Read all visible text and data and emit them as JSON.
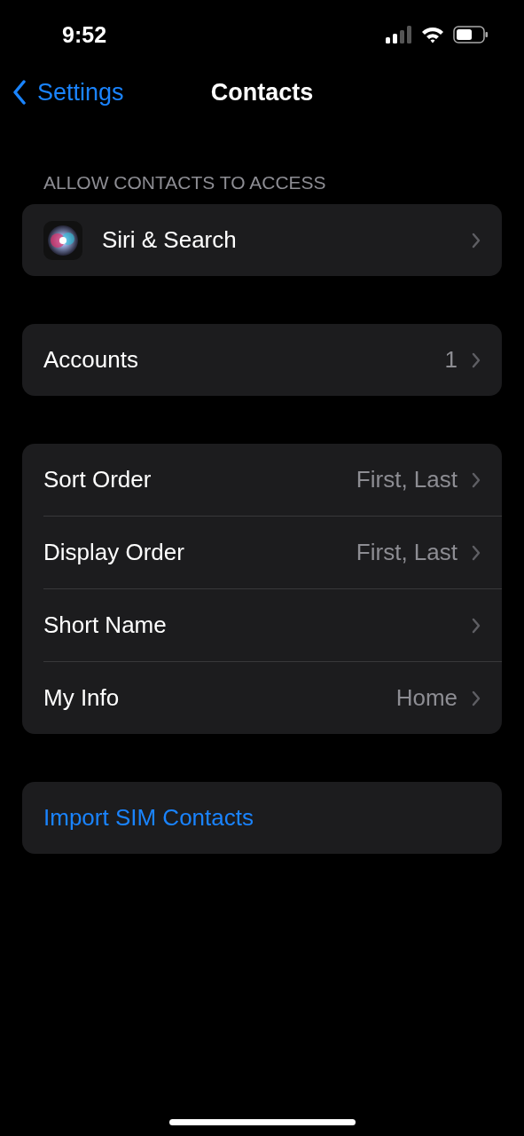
{
  "status_bar": {
    "time": "9:52"
  },
  "nav": {
    "back": "Settings",
    "title": "Contacts"
  },
  "groups": [
    {
      "header": "ALLOW CONTACTS TO ACCESS",
      "rows": [
        {
          "kind": "app",
          "label": "Siri & Search"
        }
      ]
    },
    {
      "rows": [
        {
          "kind": "nav",
          "label": "Accounts",
          "value": "1"
        }
      ]
    },
    {
      "rows": [
        {
          "kind": "nav",
          "label": "Sort Order",
          "value": "First, Last"
        },
        {
          "kind": "nav",
          "label": "Display Order",
          "value": "First, Last"
        },
        {
          "kind": "nav",
          "label": "Short Name"
        },
        {
          "kind": "nav",
          "label": "My Info",
          "value": "Home"
        }
      ]
    },
    {
      "rows": [
        {
          "kind": "action",
          "label": "Import SIM Contacts"
        }
      ]
    }
  ]
}
